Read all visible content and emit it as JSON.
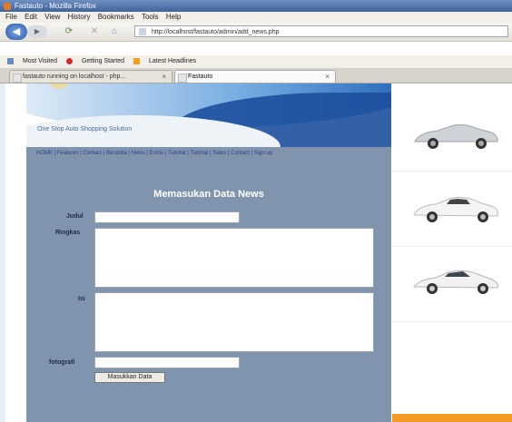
{
  "window": {
    "title": "Fastauto - Mozilla Firefox"
  },
  "menu": [
    "File",
    "Edit",
    "View",
    "History",
    "Bookmarks",
    "Tools",
    "Help"
  ],
  "navbar": {
    "url": "http://localhost/fastauto/admin/add_news.php",
    "icons": [
      "back-icon",
      "forward-icon",
      "reload-icon",
      "stop-icon",
      "home-icon"
    ]
  },
  "bookmarks": [
    "Most Visited",
    "Getting Started",
    "Latest Headlines"
  ],
  "tabs": [
    {
      "label": "fastauto running on localhost - php..."
    },
    {
      "label": "Fastauto"
    }
  ],
  "site": {
    "tagline": "One Stop Auto Shopping Solution",
    "nav_text": "HOME | Features | Contact | Beranda | News | Entrie | Tutorial | Tutorial | Sales | Contact | Sign up"
  },
  "form": {
    "title": "Memasukan Data News",
    "labels": {
      "judul": "Judul",
      "ringkas": "Ringkas",
      "isi": "Isi",
      "fotografi": "fotografi"
    },
    "values": {
      "judul": "",
      "ringkas": "",
      "isi": "",
      "fotografi": ""
    },
    "submit_label": "Masukkan Data"
  },
  "colors": {
    "panel": "#8095ad",
    "accent_orange": "#f39a25",
    "header_blue": "#1d4f9c"
  }
}
